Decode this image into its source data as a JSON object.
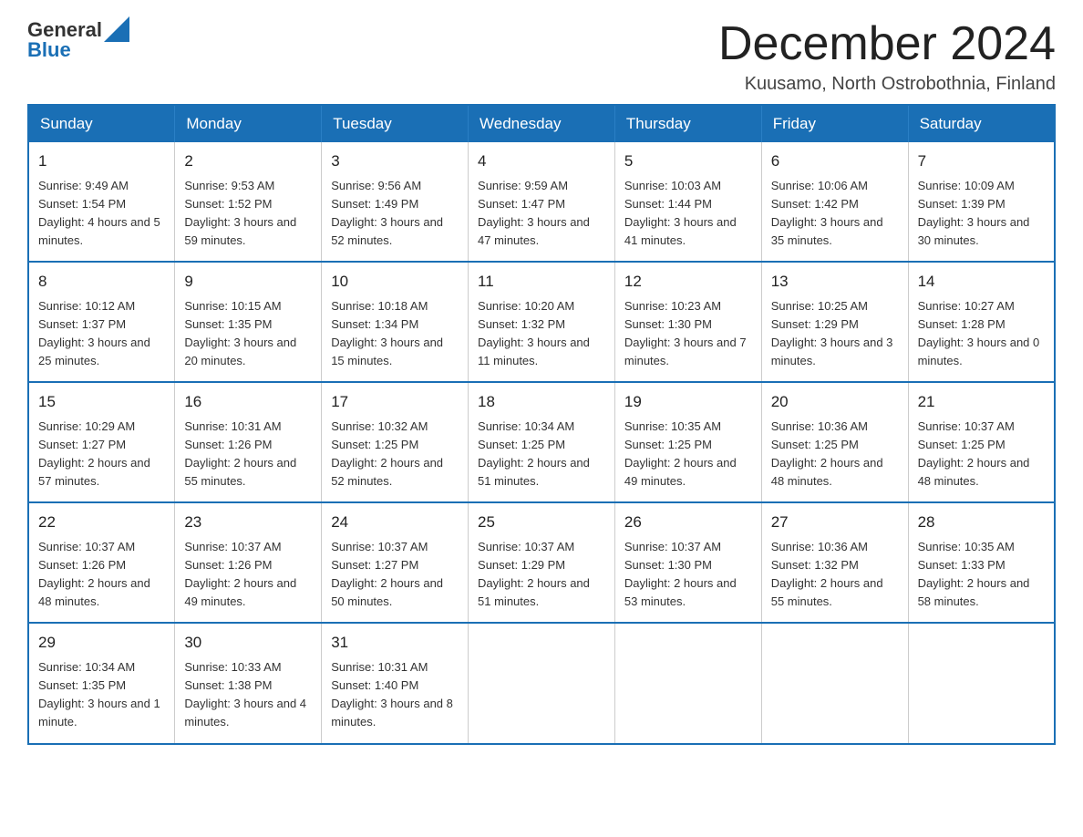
{
  "logo": {
    "general": "General",
    "blue": "Blue",
    "icon_color": "#1a6fb5"
  },
  "title": {
    "month_year": "December 2024",
    "location": "Kuusamo, North Ostrobothnia, Finland"
  },
  "days_of_week": [
    "Sunday",
    "Monday",
    "Tuesday",
    "Wednesday",
    "Thursday",
    "Friday",
    "Saturday"
  ],
  "weeks": [
    [
      {
        "day": "1",
        "sunrise": "Sunrise: 9:49 AM",
        "sunset": "Sunset: 1:54 PM",
        "daylight": "Daylight: 4 hours and 5 minutes."
      },
      {
        "day": "2",
        "sunrise": "Sunrise: 9:53 AM",
        "sunset": "Sunset: 1:52 PM",
        "daylight": "Daylight: 3 hours and 59 minutes."
      },
      {
        "day": "3",
        "sunrise": "Sunrise: 9:56 AM",
        "sunset": "Sunset: 1:49 PM",
        "daylight": "Daylight: 3 hours and 52 minutes."
      },
      {
        "day": "4",
        "sunrise": "Sunrise: 9:59 AM",
        "sunset": "Sunset: 1:47 PM",
        "daylight": "Daylight: 3 hours and 47 minutes."
      },
      {
        "day": "5",
        "sunrise": "Sunrise: 10:03 AM",
        "sunset": "Sunset: 1:44 PM",
        "daylight": "Daylight: 3 hours and 41 minutes."
      },
      {
        "day": "6",
        "sunrise": "Sunrise: 10:06 AM",
        "sunset": "Sunset: 1:42 PM",
        "daylight": "Daylight: 3 hours and 35 minutes."
      },
      {
        "day": "7",
        "sunrise": "Sunrise: 10:09 AM",
        "sunset": "Sunset: 1:39 PM",
        "daylight": "Daylight: 3 hours and 30 minutes."
      }
    ],
    [
      {
        "day": "8",
        "sunrise": "Sunrise: 10:12 AM",
        "sunset": "Sunset: 1:37 PM",
        "daylight": "Daylight: 3 hours and 25 minutes."
      },
      {
        "day": "9",
        "sunrise": "Sunrise: 10:15 AM",
        "sunset": "Sunset: 1:35 PM",
        "daylight": "Daylight: 3 hours and 20 minutes."
      },
      {
        "day": "10",
        "sunrise": "Sunrise: 10:18 AM",
        "sunset": "Sunset: 1:34 PM",
        "daylight": "Daylight: 3 hours and 15 minutes."
      },
      {
        "day": "11",
        "sunrise": "Sunrise: 10:20 AM",
        "sunset": "Sunset: 1:32 PM",
        "daylight": "Daylight: 3 hours and 11 minutes."
      },
      {
        "day": "12",
        "sunrise": "Sunrise: 10:23 AM",
        "sunset": "Sunset: 1:30 PM",
        "daylight": "Daylight: 3 hours and 7 minutes."
      },
      {
        "day": "13",
        "sunrise": "Sunrise: 10:25 AM",
        "sunset": "Sunset: 1:29 PM",
        "daylight": "Daylight: 3 hours and 3 minutes."
      },
      {
        "day": "14",
        "sunrise": "Sunrise: 10:27 AM",
        "sunset": "Sunset: 1:28 PM",
        "daylight": "Daylight: 3 hours and 0 minutes."
      }
    ],
    [
      {
        "day": "15",
        "sunrise": "Sunrise: 10:29 AM",
        "sunset": "Sunset: 1:27 PM",
        "daylight": "Daylight: 2 hours and 57 minutes."
      },
      {
        "day": "16",
        "sunrise": "Sunrise: 10:31 AM",
        "sunset": "Sunset: 1:26 PM",
        "daylight": "Daylight: 2 hours and 55 minutes."
      },
      {
        "day": "17",
        "sunrise": "Sunrise: 10:32 AM",
        "sunset": "Sunset: 1:25 PM",
        "daylight": "Daylight: 2 hours and 52 minutes."
      },
      {
        "day": "18",
        "sunrise": "Sunrise: 10:34 AM",
        "sunset": "Sunset: 1:25 PM",
        "daylight": "Daylight: 2 hours and 51 minutes."
      },
      {
        "day": "19",
        "sunrise": "Sunrise: 10:35 AM",
        "sunset": "Sunset: 1:25 PM",
        "daylight": "Daylight: 2 hours and 49 minutes."
      },
      {
        "day": "20",
        "sunrise": "Sunrise: 10:36 AM",
        "sunset": "Sunset: 1:25 PM",
        "daylight": "Daylight: 2 hours and 48 minutes."
      },
      {
        "day": "21",
        "sunrise": "Sunrise: 10:37 AM",
        "sunset": "Sunset: 1:25 PM",
        "daylight": "Daylight: 2 hours and 48 minutes."
      }
    ],
    [
      {
        "day": "22",
        "sunrise": "Sunrise: 10:37 AM",
        "sunset": "Sunset: 1:26 PM",
        "daylight": "Daylight: 2 hours and 48 minutes."
      },
      {
        "day": "23",
        "sunrise": "Sunrise: 10:37 AM",
        "sunset": "Sunset: 1:26 PM",
        "daylight": "Daylight: 2 hours and 49 minutes."
      },
      {
        "day": "24",
        "sunrise": "Sunrise: 10:37 AM",
        "sunset": "Sunset: 1:27 PM",
        "daylight": "Daylight: 2 hours and 50 minutes."
      },
      {
        "day": "25",
        "sunrise": "Sunrise: 10:37 AM",
        "sunset": "Sunset: 1:29 PM",
        "daylight": "Daylight: 2 hours and 51 minutes."
      },
      {
        "day": "26",
        "sunrise": "Sunrise: 10:37 AM",
        "sunset": "Sunset: 1:30 PM",
        "daylight": "Daylight: 2 hours and 53 minutes."
      },
      {
        "day": "27",
        "sunrise": "Sunrise: 10:36 AM",
        "sunset": "Sunset: 1:32 PM",
        "daylight": "Daylight: 2 hours and 55 minutes."
      },
      {
        "day": "28",
        "sunrise": "Sunrise: 10:35 AM",
        "sunset": "Sunset: 1:33 PM",
        "daylight": "Daylight: 2 hours and 58 minutes."
      }
    ],
    [
      {
        "day": "29",
        "sunrise": "Sunrise: 10:34 AM",
        "sunset": "Sunset: 1:35 PM",
        "daylight": "Daylight: 3 hours and 1 minute."
      },
      {
        "day": "30",
        "sunrise": "Sunrise: 10:33 AM",
        "sunset": "Sunset: 1:38 PM",
        "daylight": "Daylight: 3 hours and 4 minutes."
      },
      {
        "day": "31",
        "sunrise": "Sunrise: 10:31 AM",
        "sunset": "Sunset: 1:40 PM",
        "daylight": "Daylight: 3 hours and 8 minutes."
      },
      null,
      null,
      null,
      null
    ]
  ]
}
